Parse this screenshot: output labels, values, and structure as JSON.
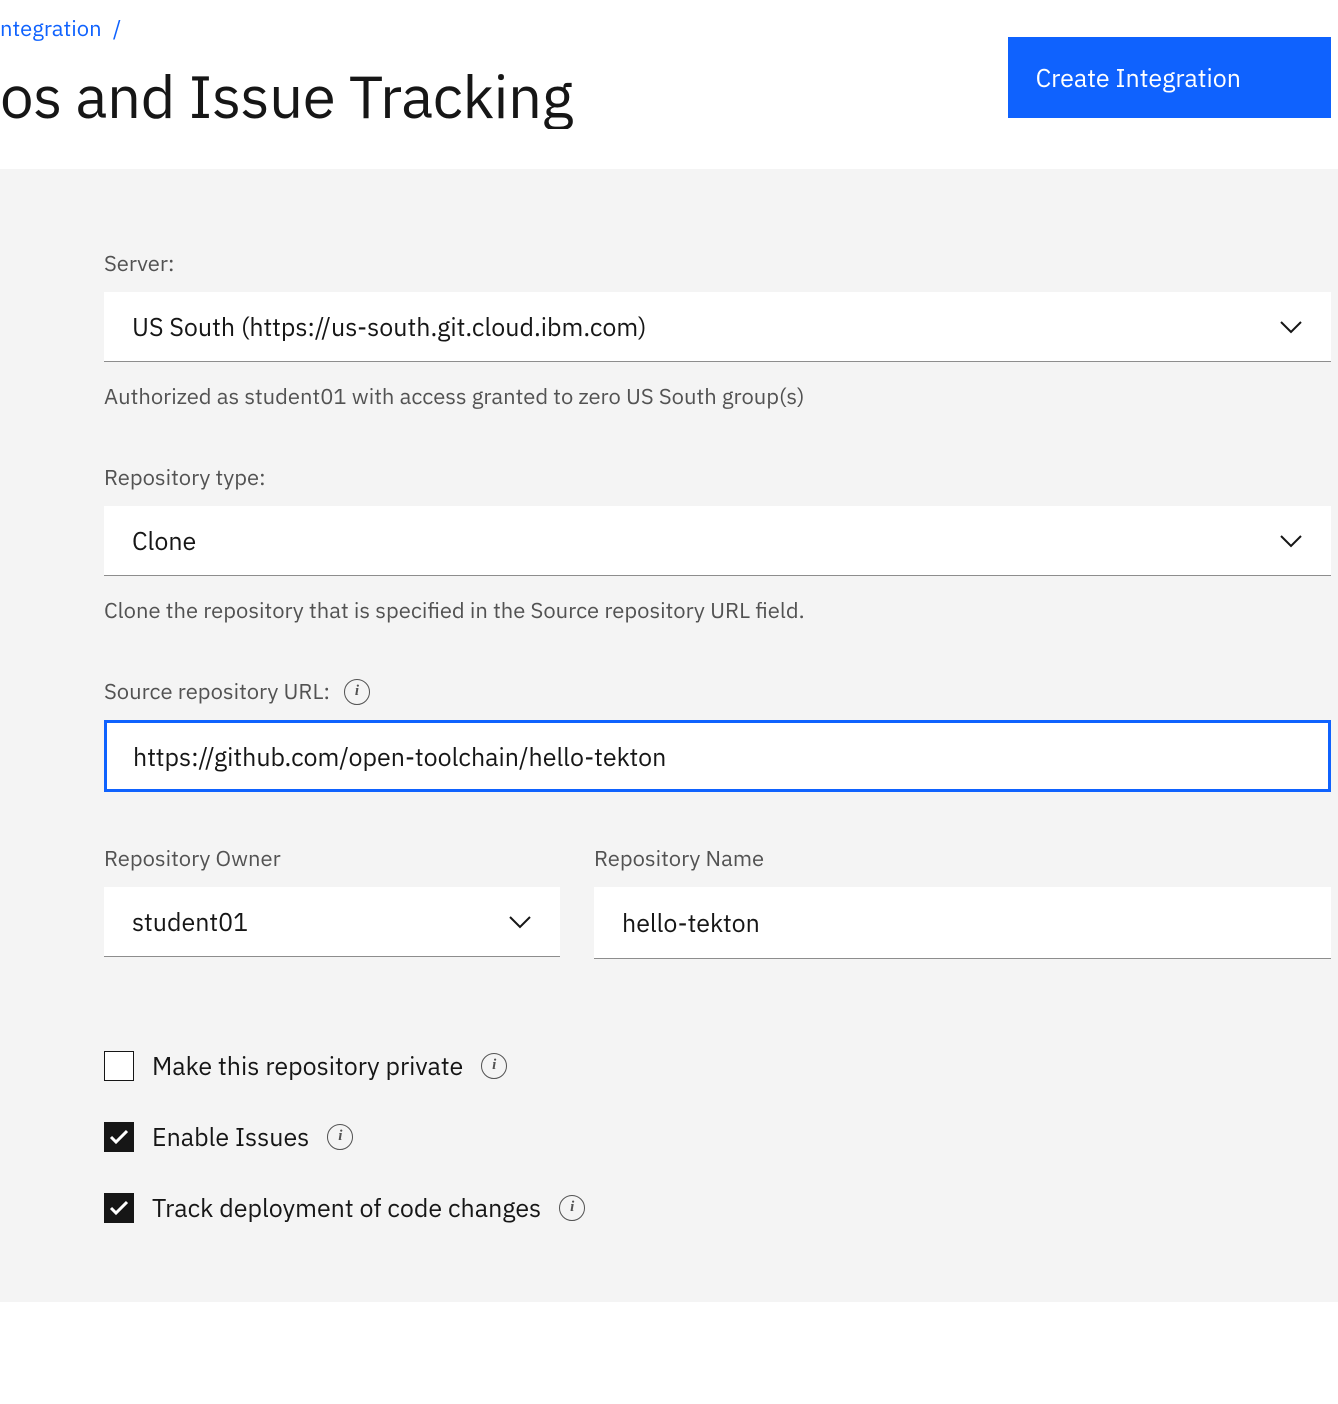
{
  "breadcrumb": {
    "link": "ntegration",
    "sep": "/"
  },
  "page_title": "os and Issue Tracking",
  "create_btn": "Create Integration",
  "server": {
    "label": "Server:",
    "value": "US South (https://us-south.git.cloud.ibm.com)",
    "helper": "Authorized as student01 with access granted to zero US South group(s)"
  },
  "repo_type": {
    "label": "Repository type:",
    "value": "Clone",
    "helper": "Clone the repository that is specified in the Source repository URL field."
  },
  "source_url": {
    "label": "Source repository URL:",
    "value": "https://github.com/open-toolchain/hello-tekton"
  },
  "owner": {
    "label": "Repository Owner",
    "value": "student01"
  },
  "repo_name": {
    "label": "Repository Name",
    "value": "hello-tekton"
  },
  "checkboxes": {
    "private": {
      "label": "Make this repository private",
      "checked": false
    },
    "issues": {
      "label": "Enable Issues",
      "checked": true
    },
    "track": {
      "label": "Track deployment of code changes",
      "checked": true
    }
  }
}
